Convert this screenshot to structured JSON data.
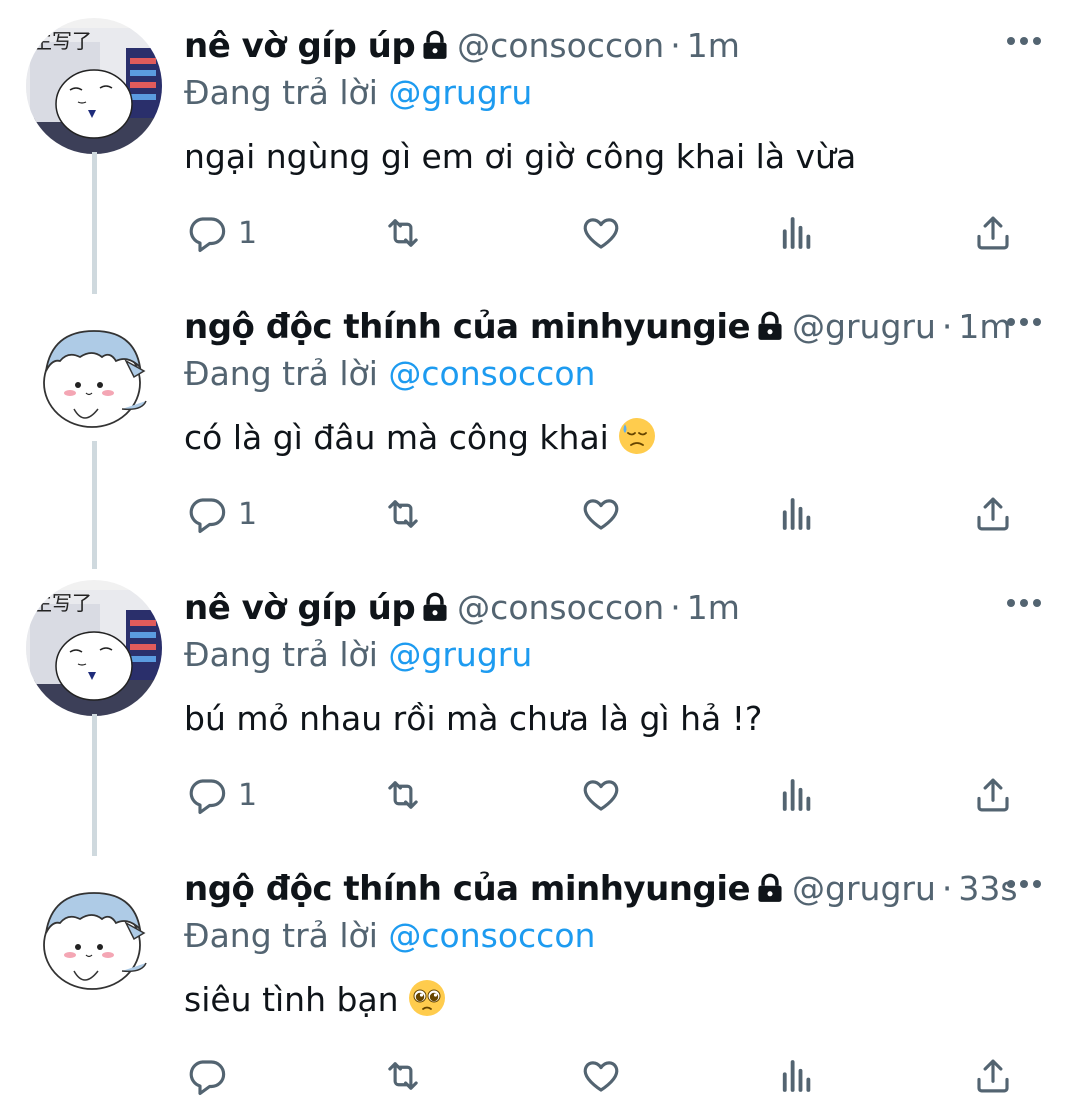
{
  "reply_prefix": "Đang trả lời",
  "colors": {
    "name": "#0f1419",
    "secondary": "#536471",
    "mention": "#1d9bf0",
    "thread_line": "#cfd9de"
  },
  "tweets": [
    {
      "name": "nê vờ gíp úp",
      "handle": "@consoccon",
      "separator": "·",
      "time": "1m",
      "reply_to": "@grugru",
      "text": "ngại ngùng gì em ơi giờ công khai là vừa",
      "emoji": "",
      "reply_count": "1",
      "avatar": "avatar-1",
      "avatar_text": "生写了"
    },
    {
      "name": "ngộ độc thính của minhyungie",
      "handle": "@grugru",
      "separator": "·",
      "time": "1m",
      "reply_to": "@consoccon",
      "text": "có là gì đâu mà công khai",
      "emoji": "downcast-face-with-sweat",
      "reply_count": "1",
      "avatar": "avatar-2"
    },
    {
      "name": "nê vờ gíp úp",
      "handle": "@consoccon",
      "separator": "·",
      "time": "1m",
      "reply_to": "@grugru",
      "text": "bú mỏ nhau rồi mà chưa là gì hả !?",
      "emoji": "",
      "reply_count": "1",
      "avatar": "avatar-1",
      "avatar_text": "生写了"
    },
    {
      "name": "ngộ độc thính của minhyungie",
      "handle": "@grugru",
      "separator": "·",
      "time": "33s",
      "reply_to": "@consoccon",
      "text": "siêu tình bạn",
      "emoji": "pleading-face",
      "reply_count": "",
      "avatar": "avatar-2"
    }
  ]
}
